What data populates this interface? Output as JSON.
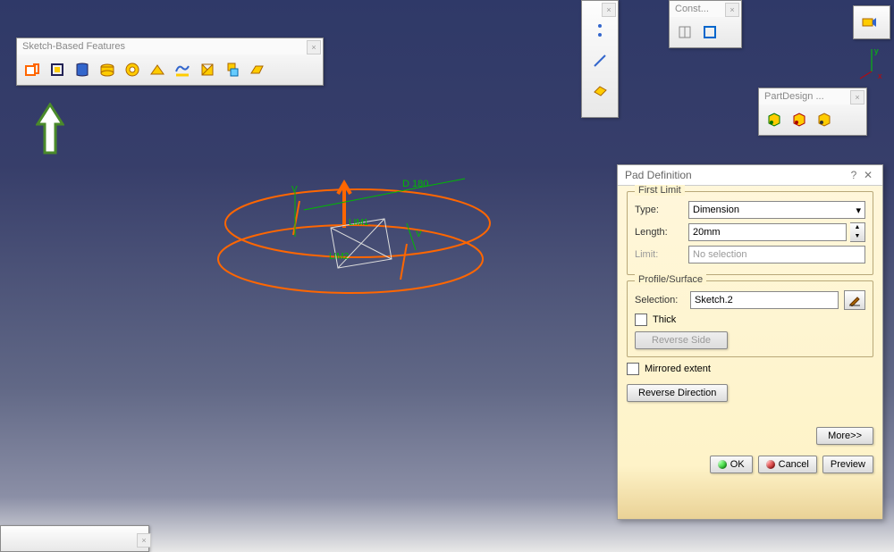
{
  "toolbars": {
    "sketch_features": {
      "title": "Sketch-Based Features",
      "tools": [
        "pad",
        "pocket",
        "shaft",
        "groove",
        "hole",
        "rib",
        "multi-sections",
        "removed-multi",
        "solid-combine",
        "stiffener"
      ]
    },
    "const_toolbar": {
      "title": "Const..."
    },
    "partdesign_toolbar": {
      "title": "PartDesign ..."
    }
  },
  "sketch_labels": {
    "dim": "D 180",
    "lim1": "LIM1",
    "lim2": "LIM2",
    "v1": "V",
    "v2": "V"
  },
  "dialog": {
    "title": "Pad Definition",
    "help": "?",
    "group_first_limit": "First Limit",
    "type_label": "Type:",
    "type_value": "Dimension",
    "length_label": "Length:",
    "length_value": "20mm",
    "limit_label": "Limit:",
    "limit_value": "No selection",
    "group_profile": "Profile/Surface",
    "selection_label": "Selection:",
    "selection_value": "Sketch.2",
    "thick_label": "Thick",
    "reverse_side": "Reverse Side",
    "mirrored_label": "Mirrored extent",
    "reverse_direction": "Reverse Direction",
    "more": "More>>",
    "ok": "OK",
    "cancel": "Cancel",
    "preview": "Preview"
  }
}
